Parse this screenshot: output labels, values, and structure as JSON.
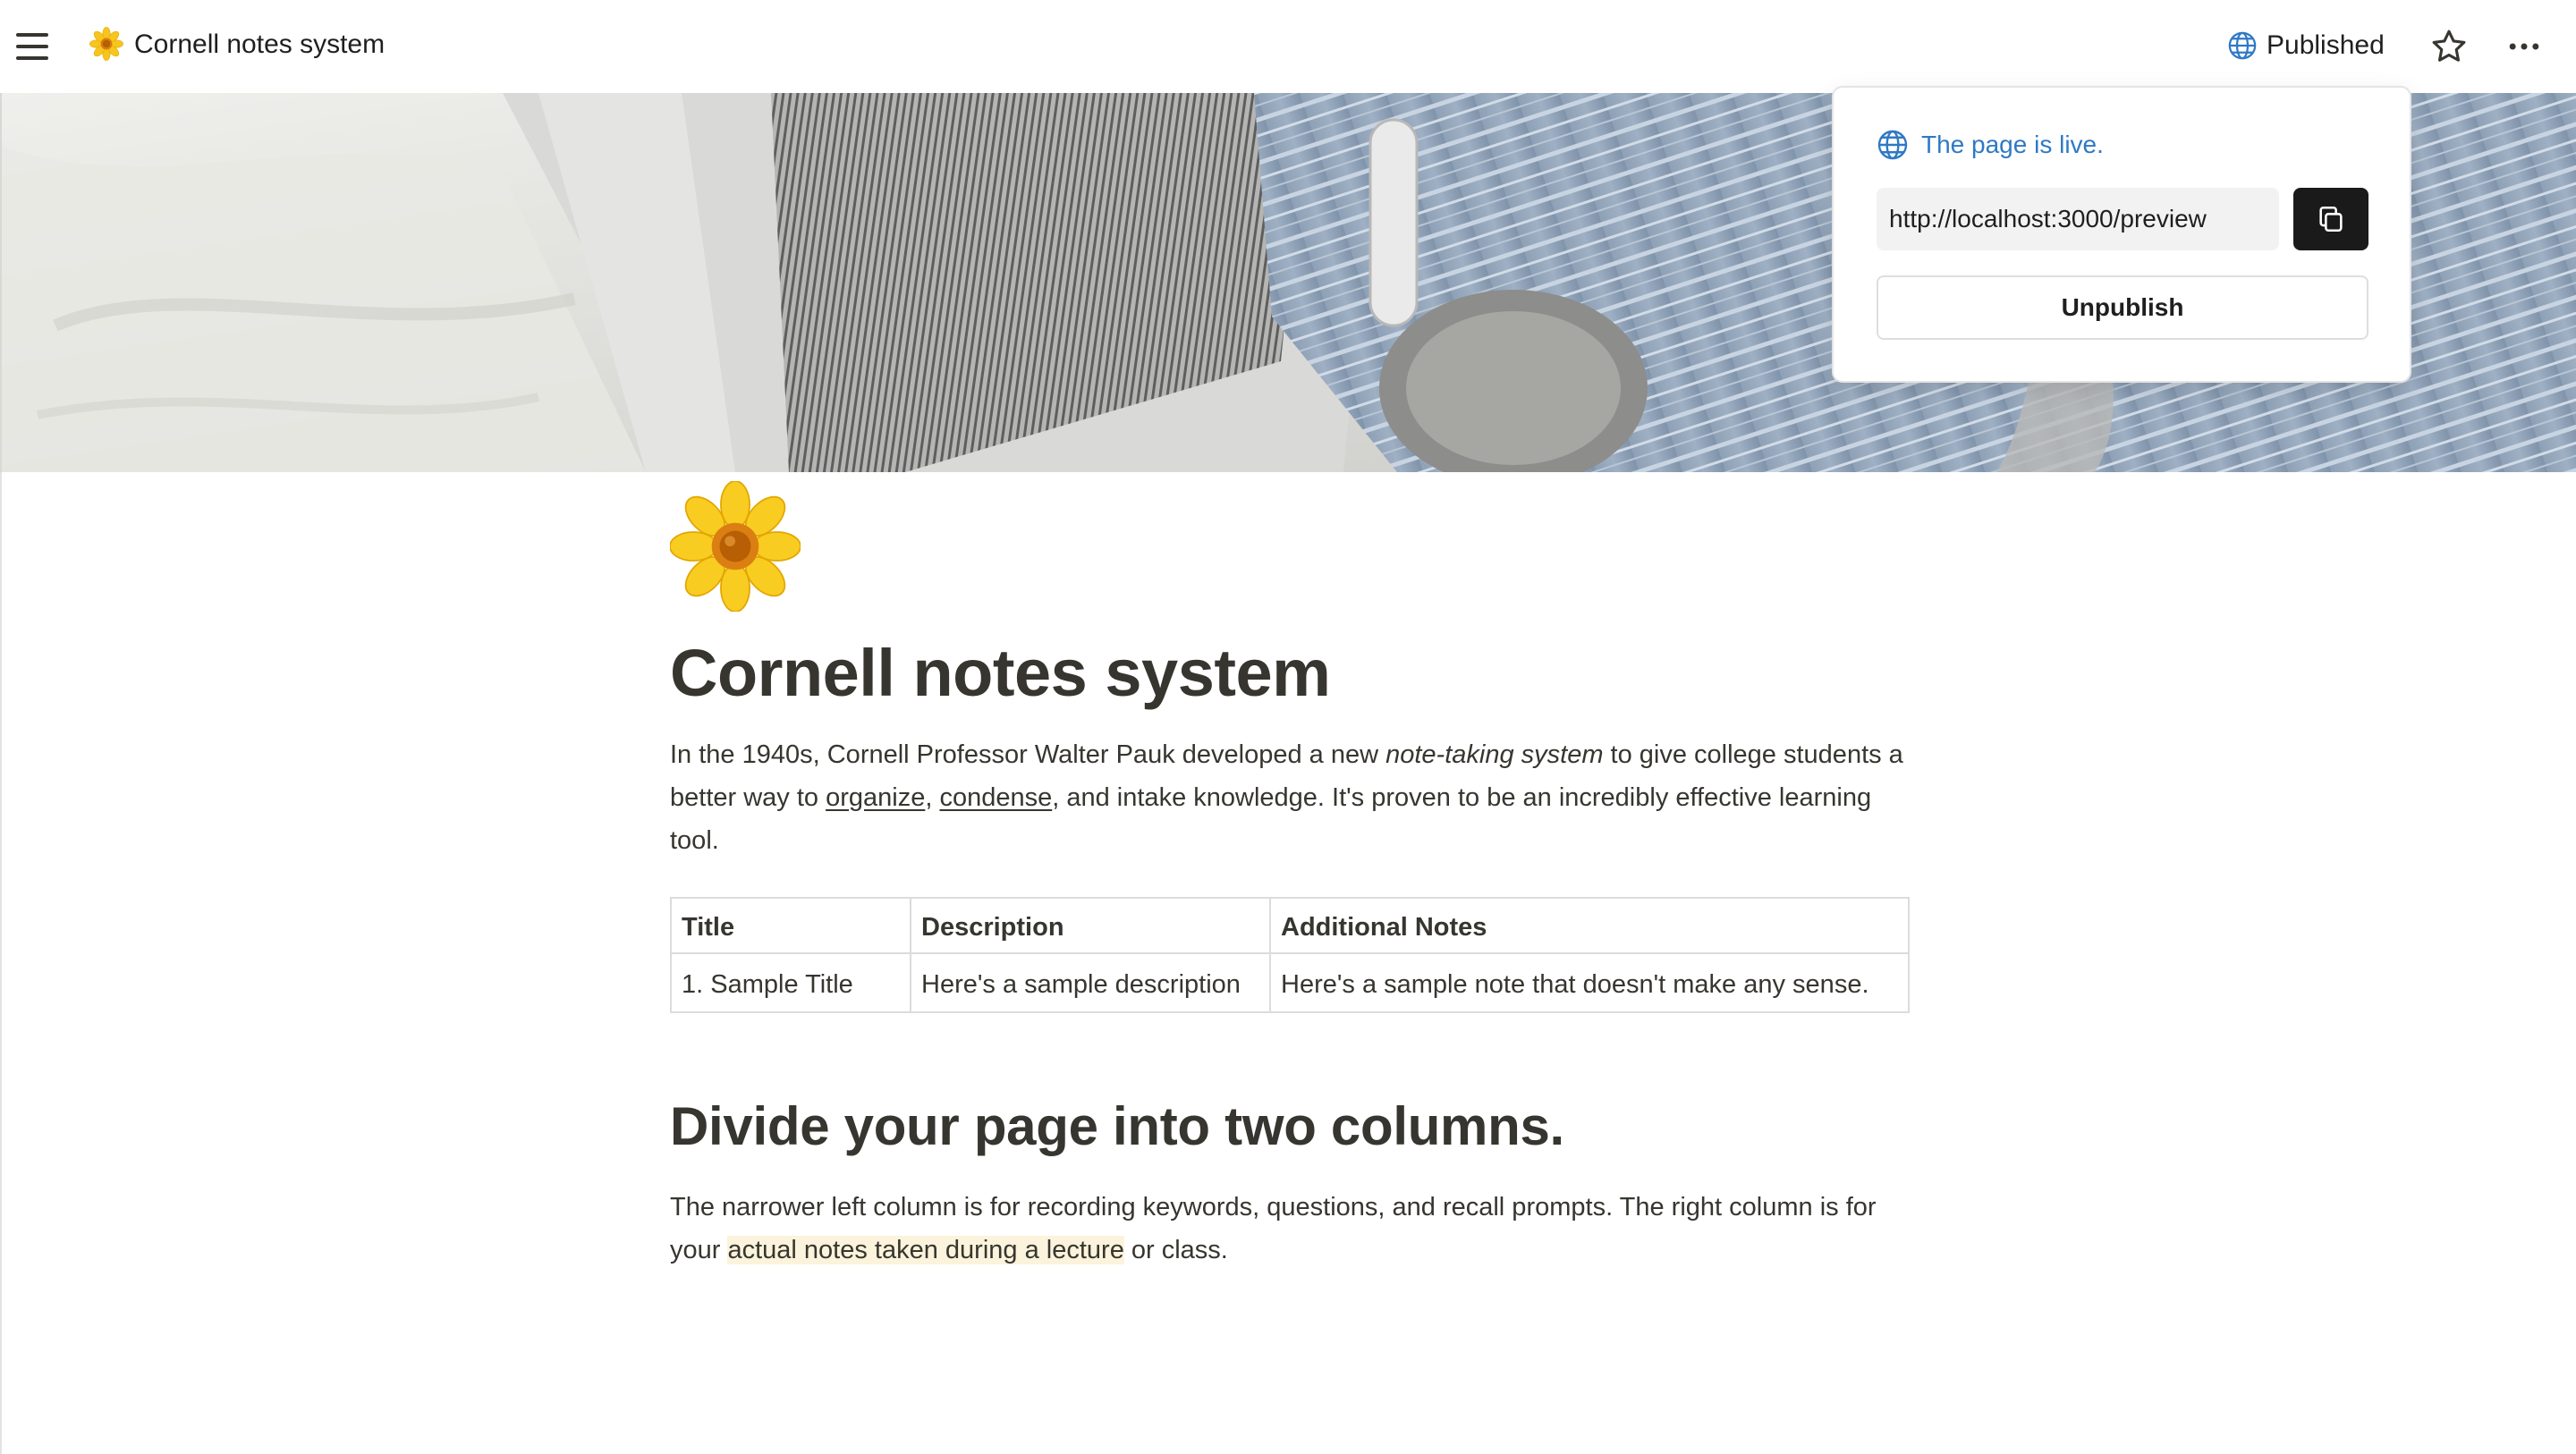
{
  "topbar": {
    "breadcrumb_title": "Cornell notes system",
    "published_label": "Published",
    "icons": [
      "menu-icon",
      "sunflower-icon",
      "globe-icon",
      "star-icon",
      "more-icon"
    ]
  },
  "popover": {
    "status_text": "The page is live.",
    "url_value": "http://localhost:3000/preview",
    "unpublish_label": "Unpublish",
    "icons": [
      "globe-icon",
      "copy-icon"
    ]
  },
  "page": {
    "title": "Cornell notes system",
    "intro": {
      "text_1": "In the 1940s, Cornell Professor Walter Pauk developed a new ",
      "italic": "note-taking system",
      "text_2": " to give college students a better way to ",
      "link_1": "organize",
      "sep": ", ",
      "link_2": "condense",
      "text_3": ", and intake knowledge. It's proven to be an incredibly effective learning tool."
    },
    "table": {
      "headers": [
        "Title",
        "Description",
        "Additional Notes"
      ],
      "rows": [
        [
          "1. Sample Title",
          "Here's a sample description",
          "Here's a sample note that doesn't make any sense."
        ]
      ]
    },
    "section_heading": "Divide your page into two columns.",
    "section_text": {
      "text_1": "The narrower left column is for recording keywords, questions, and recall prompts. The right column is for your ",
      "highlight": "actual notes taken during a lecture",
      "text_2": " or class."
    }
  },
  "colors": {
    "text": "#37352f",
    "accent_blue": "#2f79c5",
    "highlight_yellow": "#fbf3db",
    "copy_button": "#1a1a1a"
  }
}
